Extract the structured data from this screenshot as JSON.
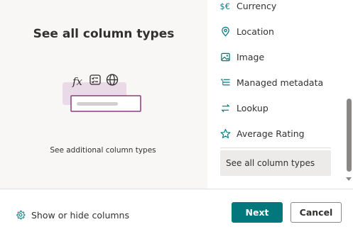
{
  "left": {
    "title": "See all column types",
    "caption": "See additional column types",
    "illustration_icons": [
      "function-icon",
      "checklist-icon",
      "globe-icon"
    ]
  },
  "menu": {
    "items": [
      {
        "label": "Currency",
        "icon": "currency-icon"
      },
      {
        "label": "Location",
        "icon": "location-pin-icon"
      },
      {
        "label": "Image",
        "icon": "image-icon"
      },
      {
        "label": "Managed metadata",
        "icon": "managed-metadata-icon"
      },
      {
        "label": "Lookup",
        "icon": "lookup-arrows-icon"
      },
      {
        "label": "Average Rating",
        "icon": "star-icon"
      }
    ],
    "see_all": "See all column types"
  },
  "footer": {
    "show_hide": "Show or hide columns",
    "next": "Next",
    "cancel": "Cancel"
  },
  "colors": {
    "accent": "#03787c",
    "left_bg": "#f8f7f6",
    "illus_block": "#ead9e7",
    "illus_border": "#8c3c7c",
    "selected_bg": "#edebe9"
  }
}
